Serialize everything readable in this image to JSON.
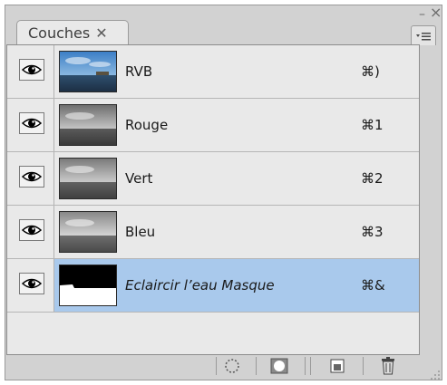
{
  "panel": {
    "tab": {
      "label": "Couches",
      "close_glyph": "✕"
    },
    "window_controls": {
      "minimize": "–",
      "close": "×"
    },
    "menu_icon": "panel-menu-icon"
  },
  "channels": [
    {
      "name": "RVB",
      "shortcut": "⌘)",
      "visible": true,
      "thumbnail": "color-seascape",
      "selected": false
    },
    {
      "name": "Rouge",
      "shortcut": "⌘1",
      "visible": true,
      "thumbnail": "gray-seascape",
      "selected": false
    },
    {
      "name": "Vert",
      "shortcut": "⌘2",
      "visible": true,
      "thumbnail": "gray-seascape",
      "selected": false
    },
    {
      "name": "Bleu",
      "shortcut": "⌘3",
      "visible": true,
      "thumbnail": "gray-seascape",
      "selected": false
    },
    {
      "name": "Eclaircir l’eau Masque",
      "shortcut": "⌘&",
      "visible": true,
      "thumbnail": "mask",
      "selected": true
    }
  ],
  "toolbar": {
    "buttons": [
      "load-selection-icon",
      "save-selection-icon",
      "new-channel-icon",
      "trash-icon"
    ]
  },
  "colors": {
    "selection": "#a9c9ec",
    "panel": "#d2d2d2",
    "list": "#e9e9e9"
  }
}
